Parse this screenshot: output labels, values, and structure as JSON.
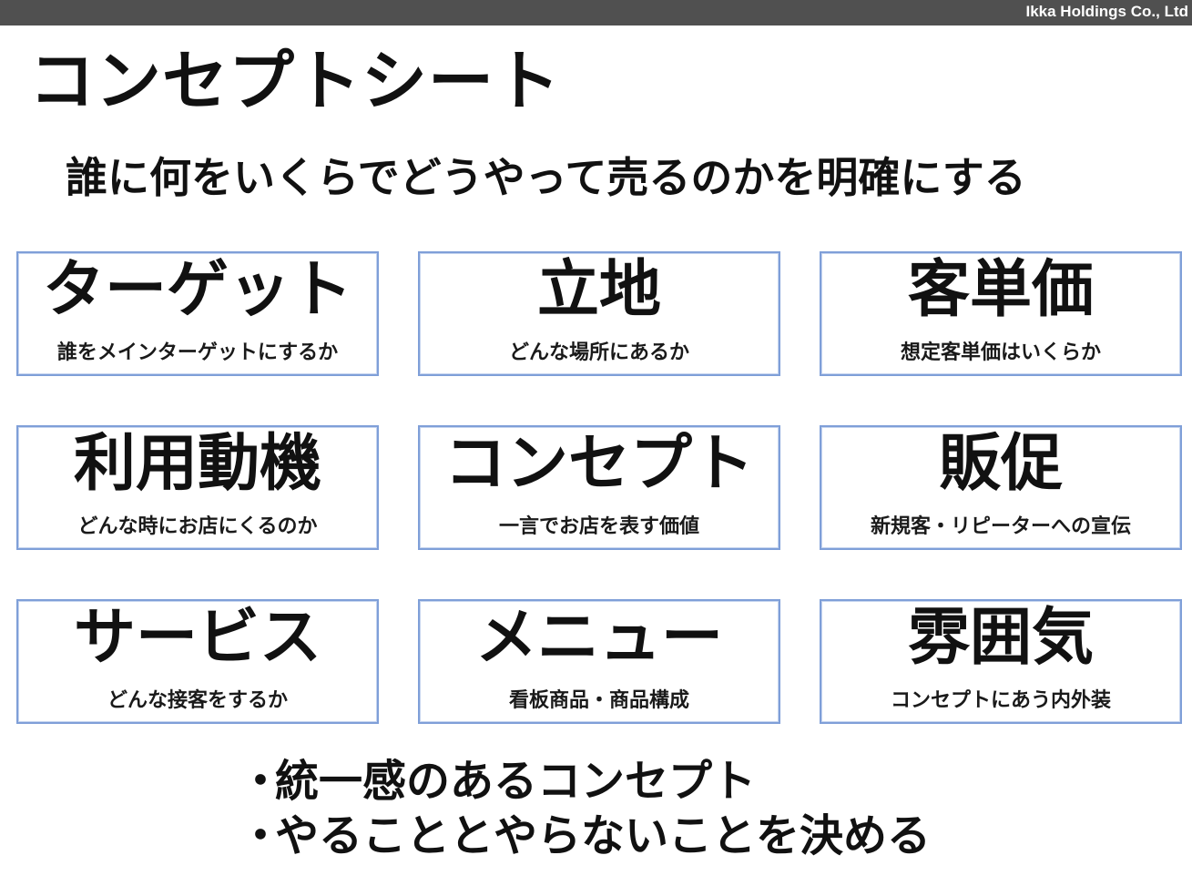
{
  "header": {
    "company": "Ikka Holdings Co., Ltd"
  },
  "title": "コンセプトシート",
  "subtitle": "誰に何をいくらでどうやって売るのかを明確にする",
  "cards": [
    {
      "title": "ターゲット",
      "desc": "誰をメインターゲットにするか"
    },
    {
      "title": "立地",
      "desc": "どんな場所にあるか"
    },
    {
      "title": "客単価",
      "desc": "想定客単価はいくらか"
    },
    {
      "title": "利用動機",
      "desc": "どんな時にお店にくるのか"
    },
    {
      "title": "コンセプト",
      "desc": "一言でお店を表す価値"
    },
    {
      "title": "販促",
      "desc": "新規客・リピーターへの宣伝"
    },
    {
      "title": "サービス",
      "desc": "どんな接客をするか"
    },
    {
      "title": "メニュー",
      "desc": "看板商品・商品構成"
    },
    {
      "title": "雰囲気",
      "desc": "コンセプトにあう内外装"
    }
  ],
  "bullets": [
    {
      "mark": "・",
      "text": "統一感のあるコンセプト"
    },
    {
      "mark": "・",
      "text": "やることとやらないことを決める"
    }
  ],
  "colors": {
    "topbar": "#505050",
    "card_border": "#7f9fd8"
  }
}
